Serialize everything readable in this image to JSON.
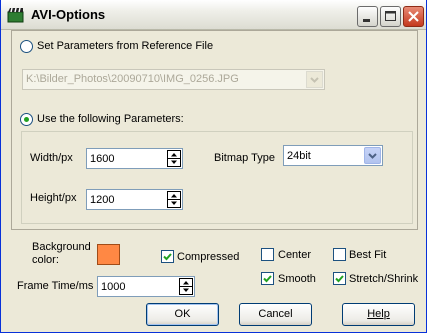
{
  "window": {
    "title": "AVI-Options"
  },
  "titlebar": {
    "icon": "clapperboard-icon",
    "minimize_icon": "minimize-icon",
    "maximize_icon": "maximize-icon",
    "close_icon": "close-icon"
  },
  "reference": {
    "label": "Set Parameters from Reference File",
    "selected": false,
    "file_path": "K:\\Bilder_Photos\\20090710\\IMG_0256.JPG"
  },
  "parameters": {
    "label": "Use the following Parameters:",
    "selected": true,
    "width_label": "Width/px",
    "width_value": "1600",
    "height_label": "Height/px",
    "height_value": "1200",
    "bitmap_type_label": "Bitmap Type",
    "bitmap_type_value": "24bit"
  },
  "options": {
    "background_label_line1": "Background",
    "background_label_line2": "color:",
    "background_color": "#ff8844",
    "compressed_label": "Compressed",
    "compressed_checked": true,
    "center_label": "Center",
    "center_checked": false,
    "best_fit_label": "Best Fit",
    "best_fit_checked": false,
    "smooth_label": "Smooth",
    "smooth_checked": true,
    "stretch_label": "Stretch/Shrink",
    "stretch_checked": true,
    "frame_time_label": "Frame Time/ms",
    "frame_time_value": "1000"
  },
  "buttons": {
    "ok": "OK",
    "cancel": "Cancel",
    "help": "Help"
  },
  "colors": {
    "title_bar_text": "#000000",
    "dialog_background": "#ece9d8",
    "radio_selected_dot": "#21a121",
    "checkmark": "#21a121",
    "close_button": "#c4391e"
  }
}
